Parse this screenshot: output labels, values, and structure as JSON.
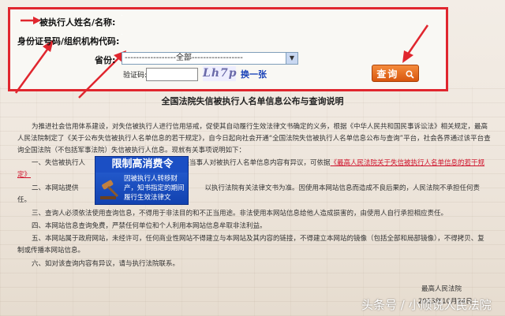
{
  "search_form": {
    "name_label": "被执行人姓名/名称:",
    "id_label": "身份证号码/组织机构代码:",
    "province_label": "省份:",
    "province_selected": "------------------全部------------------",
    "captcha_label": "验证码:",
    "captcha_text": "Lh7p",
    "refresh_label": "换一张",
    "query_label": "查询"
  },
  "notice": {
    "title": "全国法院失信被执行人名单信息公布与查询说明",
    "paragraphs": [
      "为推进社会信用体系建设，对失信被执行人进行信用惩戒，促使其自动履行生效法律文书确定的义务，根据《中华人民共和国民事诉讼法》相关规定，最高人民法院制定了《关于公布失信被执行人名单信息的若干规定》，自今日起向社会开通“全国法院失信被执行人名单信息公布与查询”平台，社会各界通过该平台查询全国法院（不包括军事法院）失信被执行人信息。现就有关事项说明如下：",
      "一、失信被执行人",
      "有关当事人对被执行人名单信息内容有异议，可依据",
      "《最高人民法院关于失信被执行人名单信息的若干规定》",
      "向执行法院",
      "二、本网站提供",
      "以执行法院有关法律文书为准。因使用本网站信息而造成不良后果的，人民法院不承担任何责任。",
      "三、查询人必须依法使用查询信息，不得用于非法目的和不正当用途。非法使用本网站信息给他人造成损害的，由使用人自行承担相应责任。",
      "四、本网站信息查询免费，严禁任何单位和个人利用本网站信息牟取非法利益。",
      "五、本网站属于政府网站，未经许可，任何商业性网站不得建立与本网站及其内容的链接，不得建立本网站的镜像（包括全部和局部镜像），不得拷贝、复制或传播本网站信息。",
      "六、如对该查询内容有异议，请与执行法院联系。"
    ],
    "signature": "最高人民法院",
    "date": "2013年10月24日"
  },
  "ad": {
    "title": "限制高消费令",
    "body": "因被执行人转移财产，知书指定的期间履行生效法律文"
  },
  "watermark": "头条号 / 小顺说人民法院",
  "colors": {
    "panel_border": "#e0262e",
    "query_button": "#e2661c",
    "link": "#d0102a",
    "ad_bg": "#1b4fc4"
  }
}
